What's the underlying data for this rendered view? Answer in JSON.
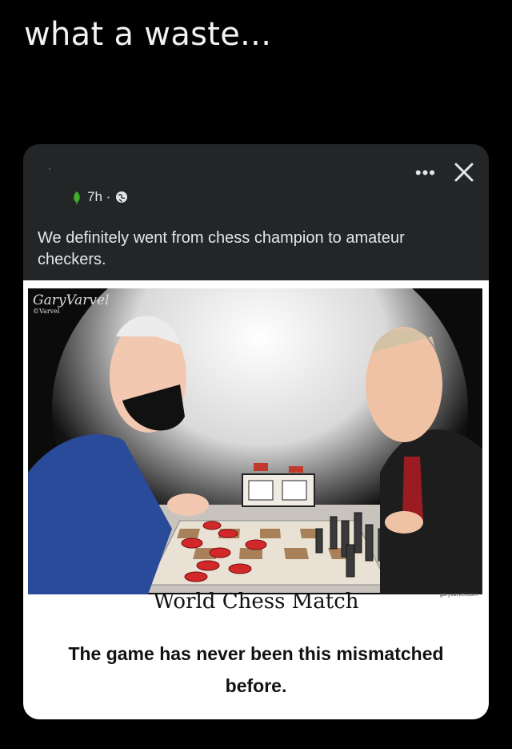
{
  "meme_caption": "what a waste...",
  "post": {
    "time": "7h ·",
    "text": "We definitely went from chess champion to amateur checkers.",
    "more_label": "•••"
  },
  "cartoon": {
    "signature": "GaryVarvel",
    "signature_sub": "©Varvel",
    "title": "World Chess Match",
    "site": "garyvarvel.com",
    "subtitle": "The game has never been this mismatched before."
  },
  "colors": {
    "page_bg": "#000000",
    "card_bg": "#242526",
    "text": "#e4e6eb"
  },
  "icons": [
    "more-icon",
    "close-icon",
    "leaf-icon",
    "globe-icon"
  ]
}
